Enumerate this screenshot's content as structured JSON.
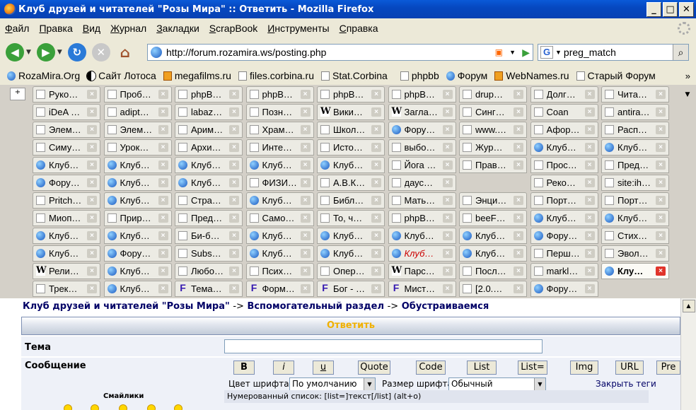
{
  "window": {
    "title": "Клуб друзей и читателей \"Розы Мира\" :: Ответить - Mozilla Firefox"
  },
  "menu": [
    "Файл",
    "Правка",
    "Вид",
    "Журнал",
    "Закладки",
    "ScrapBook",
    "Инструменты",
    "Справка"
  ],
  "nav": {
    "url": "http://forum.rozamira.ws/posting.php",
    "search": "preg_match"
  },
  "bookmarks": [
    {
      "label": "RozaMira.Org",
      "icon": "globe"
    },
    {
      "label": "Сайт Лотоса",
      "icon": "yinyang"
    },
    {
      "label": "megafilms.ru",
      "icon": "film"
    },
    {
      "label": "files.corbina.ru",
      "icon": "page"
    },
    {
      "label": "Stat.Corbina",
      "icon": "page"
    },
    {
      "label": "phpbb",
      "icon": "page"
    },
    {
      "label": "Форум",
      "icon": "globe"
    },
    {
      "label": "WebNames.ru",
      "icon": "wn"
    },
    {
      "label": "Старый Форум",
      "icon": "page"
    }
  ],
  "tabs": [
    [
      "Руко…",
      "Проб…",
      "phpB…",
      "phpB…",
      "phpB…",
      "phpB…",
      "drup…",
      "Долг…",
      "Чита…"
    ],
    [
      "iDeA …",
      "adipt…",
      "labaz…",
      "Позн…",
      "Вики…",
      "Загла…",
      "Синг…",
      "Coan",
      "antira…"
    ],
    [
      "Элем…",
      "Элем…",
      "Арим…",
      "Храм…",
      "Школ…",
      "Фору…",
      "www.…",
      "Афор…",
      "Расп…"
    ],
    [
      "Симу…",
      "Урок…",
      "Архи…",
      "Инте…",
      "Исто…",
      "выбо…",
      "Жур…",
      "Клуб…",
      "Клуб…"
    ],
    [
      "Клуб…",
      "Клуб…",
      "Клуб…",
      "Клуб…",
      "Клуб…",
      "Йога …",
      "Прав…",
      "Прос…",
      "Пред…"
    ],
    [
      "Фору…",
      "Клуб…",
      "Клуб…",
      "ФИЗИ…",
      "А.В.К…",
      "даус…",
      "Реко…",
      "site:ih…"
    ],
    [
      "Pritch…",
      "Клуб…",
      "Стра…",
      "Клуб…",
      "Библ…",
      "Мать…",
      "Энци…",
      "Порт…",
      "Порт…"
    ],
    [
      "Миоп…",
      "Прир…",
      "Пред…",
      "Само…",
      "То, ч…",
      "phpB…",
      "beeF…",
      "Клуб…",
      "Клуб…"
    ],
    [
      "Клуб…",
      "Клуб…",
      "Би-б…",
      "Клуб…",
      "Клуб…",
      "Клуб…",
      "Клуб…",
      "Фору…",
      "Стих…"
    ],
    [
      "Клуб…",
      "Фору…",
      "Subs…",
      "Клуб…",
      "Клуб…",
      "Клуб…",
      "Клуб…",
      "Перш…",
      "Эвол…"
    ],
    [
      "Рели…",
      "Клуб…",
      "Любо…",
      "Псих…",
      "Опер…",
      "Парс…",
      "Посл…",
      "markl…",
      "Клу…"
    ],
    [
      "Трек…",
      "Клуб…",
      "Тема…",
      "Форм…",
      "Бог - …",
      "Мист…",
      "[2.0.…",
      "Фору…"
    ]
  ],
  "breadcrumb": {
    "a": "Клуб друзей и читателей \"Розы Мира\"",
    "sep": "->",
    "b": "Вспомогательный раздел",
    "c": "Обустраиваемся"
  },
  "form": {
    "header": "Ответить",
    "topic_label": "Тема",
    "message_label": "Сообщение",
    "smileys_label": "Смайлики",
    "buttons": [
      "B",
      "i",
      "u",
      "Quote",
      "Code",
      "List",
      "List=",
      "Img",
      "URL",
      "Pre"
    ],
    "font_color_label": "Цвет шрифта:",
    "font_color_value": "По умолчанию",
    "font_size_label": "Размер шрифта:",
    "font_size_value": "Обычный",
    "close_tags": "Закрыть теги",
    "help": "Нумерованный список: [list=]текст[/list]  (alt+o)"
  }
}
